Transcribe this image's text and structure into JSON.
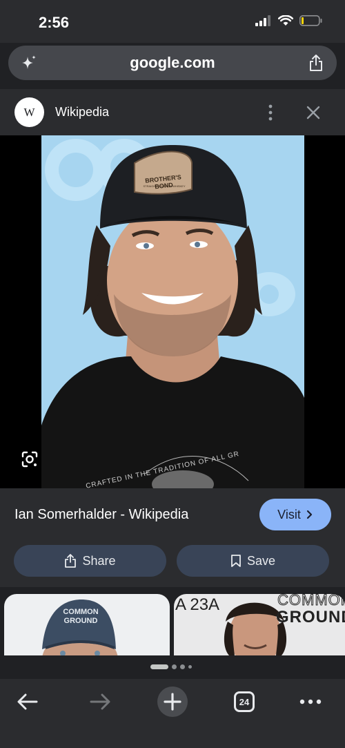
{
  "status": {
    "time": "2:56"
  },
  "browser": {
    "url": "google.com"
  },
  "source": {
    "logo_letter": "W",
    "name": "Wikipedia"
  },
  "image": {
    "cap_patch_line1": "BROTHER'S BOND",
    "cap_patch_line2": "STRAIGHT BOURBON WHISKEY",
    "shirt_text": "CRAFTED IN THE TRADITION OF ALL GR"
  },
  "result": {
    "title": "Ian Somerhalder - Wikipedia",
    "visit_label": "Visit"
  },
  "actions": {
    "share_label": "Share",
    "save_label": "Save"
  },
  "related": {
    "thumb1": {
      "cap_line1": "COMMON",
      "cap_line2": "GROUND"
    },
    "thumb2": {
      "bg_text_1": "A 23A",
      "bg_text_2": "COMMON",
      "bg_text_3": "GROUND"
    }
  },
  "bottom_nav": {
    "tab_count": "24"
  }
}
